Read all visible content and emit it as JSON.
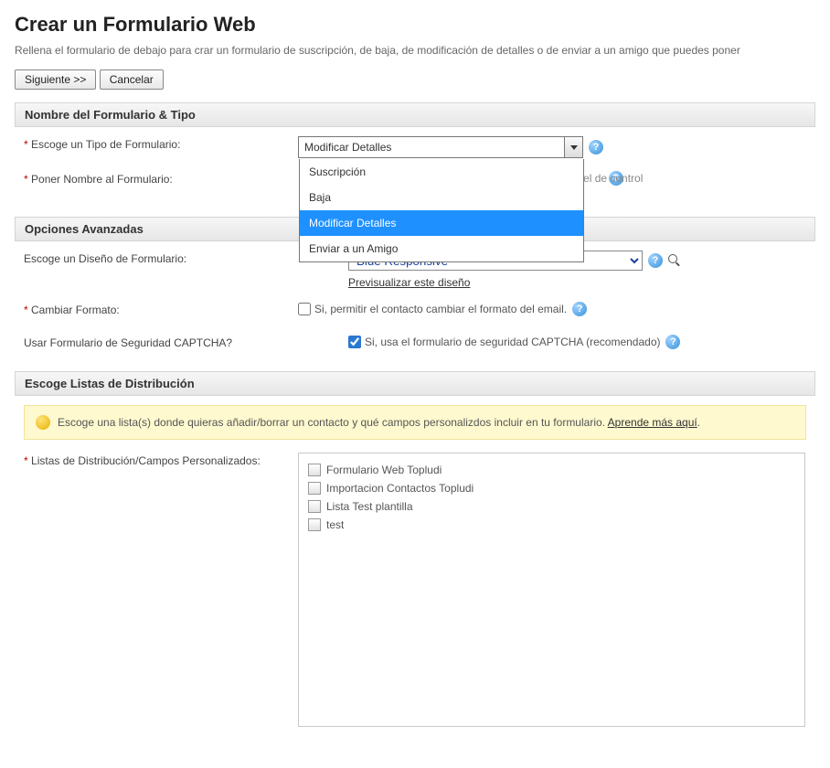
{
  "page": {
    "title": "Crear un Formulario Web",
    "intro": "Rellena el formulario de debajo para crar un formulario de suscripción, de baja, de modificación de detalles o de enviar a un amigo que puedes poner"
  },
  "buttons": {
    "next": "Siguiente >>",
    "cancel": "Cancelar"
  },
  "sections": {
    "nameType": "Nombre del Formulario & Tipo",
    "advanced": "Opciones Avanzadas",
    "lists": "Escoge Listas de Distribución"
  },
  "fields": {
    "formType": {
      "label": "Escoge un Tipo de Formulario:",
      "selected": "Modificar Detalles",
      "options": [
        "Suscripción",
        "Baja",
        "Modificar Detalles",
        "Enviar a un Amigo"
      ]
    },
    "formName": {
      "label": "Poner Nombre al Formulario:",
      "hint": "panel de control"
    },
    "design": {
      "label": "Escoge un Diseño de Formulario:",
      "selected": "Blue Responsive",
      "previewLink": "Previsualizar este diseño"
    },
    "changeFormat": {
      "label": "Cambiar Formato:",
      "cbLabel": "Si, permitir el contacto cambiar el formato del email.",
      "checked": false
    },
    "captcha": {
      "label": "Usar Formulario de Seguridad CAPTCHA?",
      "cbLabel": "Si, usa el formulario de seguridad CAPTCHA (recomendado)",
      "checked": true
    },
    "distLists": {
      "label": "Listas de Distribución/Campos Personalizados:",
      "banner": "Escoge una lista(s) donde quieras añadir/borrar un contacto y qué campos personalizdos incluir en tu formulario. ",
      "bannerLink": "Aprende más aquí",
      "items": [
        "Formulario Web Topludi",
        "Importacion Contactos Topludi",
        "Lista Test plantilla",
        "test"
      ]
    }
  }
}
